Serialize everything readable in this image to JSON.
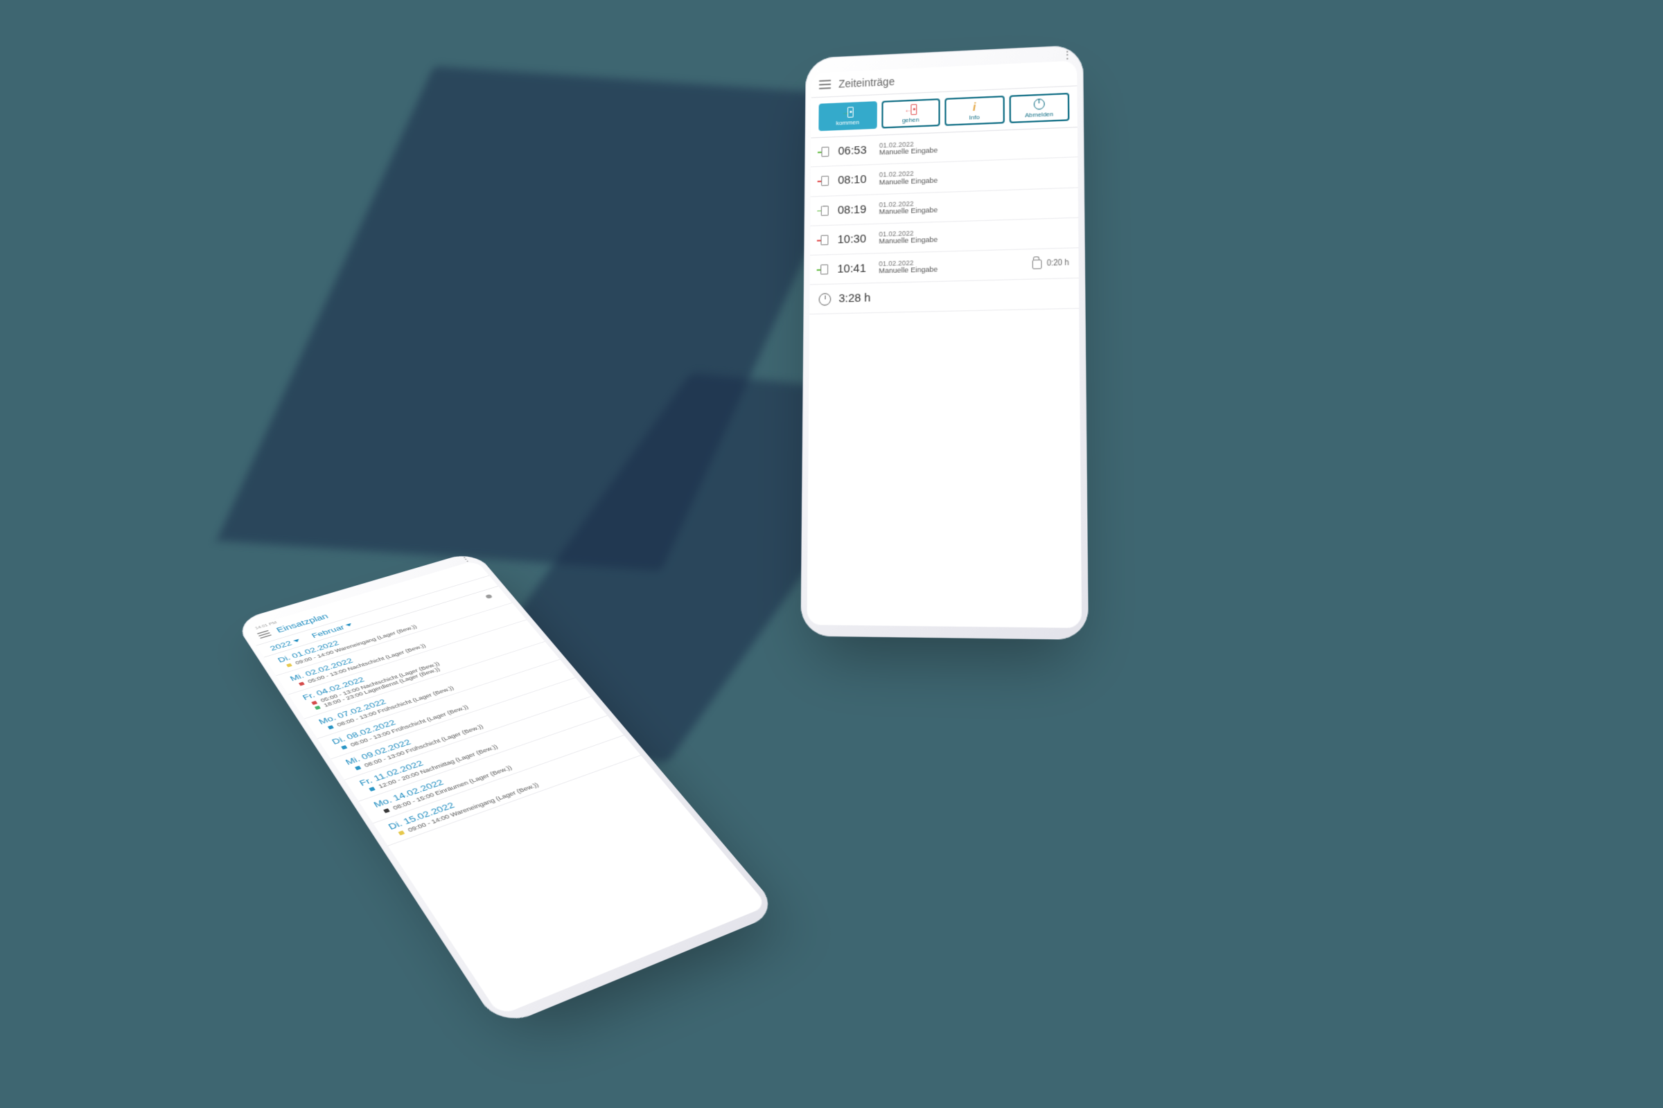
{
  "phone_a": {
    "title": "Zeiteinträge",
    "actions": {
      "kommen": "kommen",
      "gehen": "gehen",
      "info": "Info",
      "abmelden": "Abmelden"
    },
    "entries": [
      {
        "dir": "in",
        "time": "06:53",
        "date": "01.02.2022",
        "src": "Manuelle Eingabe"
      },
      {
        "dir": "out",
        "time": "08:10",
        "date": "01.02.2022",
        "src": "Manuelle Eingabe"
      },
      {
        "dir": "in",
        "time": "08:19",
        "date": "01.02.2022",
        "src": "Manuelle Eingabe"
      },
      {
        "dir": "out",
        "time": "10:30",
        "date": "01.02.2022",
        "src": "Manuelle Eingabe"
      },
      {
        "dir": "in",
        "time": "10:41",
        "date": "01.02.2022",
        "src": "Manuelle Eingabe",
        "extra": "0:20 h"
      }
    ],
    "total": "3:28 h"
  },
  "phone_b": {
    "status": "14:01 PM",
    "title": "Einsatzplan",
    "year": "2022",
    "month": "Februar",
    "days": [
      {
        "head": "Di. 01.02.2022",
        "shifts": [
          {
            "c": "#e6c84c",
            "t": "09:00 - 14:00 Wareneingang (Lager (Bew.))"
          }
        ],
        "flag": true
      },
      {
        "head": "Mi. 02.02.2022",
        "shifts": [
          {
            "c": "#d44b4b",
            "t": "05:00 - 13:00 Nachtschicht (Lager (Bew.))"
          }
        ]
      },
      {
        "head": "Fr. 04.02.2022",
        "shifts": [
          {
            "c": "#d44b4b",
            "t": "05:00 - 13:00 Nachtschicht (Lager (Bew.))"
          },
          {
            "c": "#47b36b",
            "t": "18:00 - 23:00 Lagerdienst (Lager (Bew.))"
          }
        ]
      },
      {
        "head": "Mo. 07.02.2022",
        "shifts": [
          {
            "c": "#2a95c5",
            "t": "08:00 - 13:00 Frühschicht (Lager (Bew.))"
          }
        ]
      },
      {
        "head": "Di. 08.02.2022",
        "shifts": [
          {
            "c": "#2a95c5",
            "t": "08:00 - 13:00 Frühschicht (Lager (Bew.))"
          }
        ]
      },
      {
        "head": "Mi. 09.02.2022",
        "shifts": [
          {
            "c": "#2a95c5",
            "t": "08:00 - 13:00 Frühschicht (Lager (Bew.))"
          }
        ]
      },
      {
        "head": "Fr. 11.02.2022",
        "shifts": [
          {
            "c": "#2a95c5",
            "t": "12:00 - 20:00 Nachmittag (Lager (Bew.))"
          }
        ]
      },
      {
        "head": "Mo. 14.02.2022",
        "shifts": [
          {
            "c": "#3a3a3a",
            "t": "08:00 - 15:00 Einräumen (Lager (Bew.))"
          }
        ]
      },
      {
        "head": "Di. 15.02.2022",
        "shifts": [
          {
            "c": "#e6c84c",
            "t": "09:00 - 14:00 Wareneingang (Lager (Bew.))"
          }
        ]
      }
    ]
  }
}
